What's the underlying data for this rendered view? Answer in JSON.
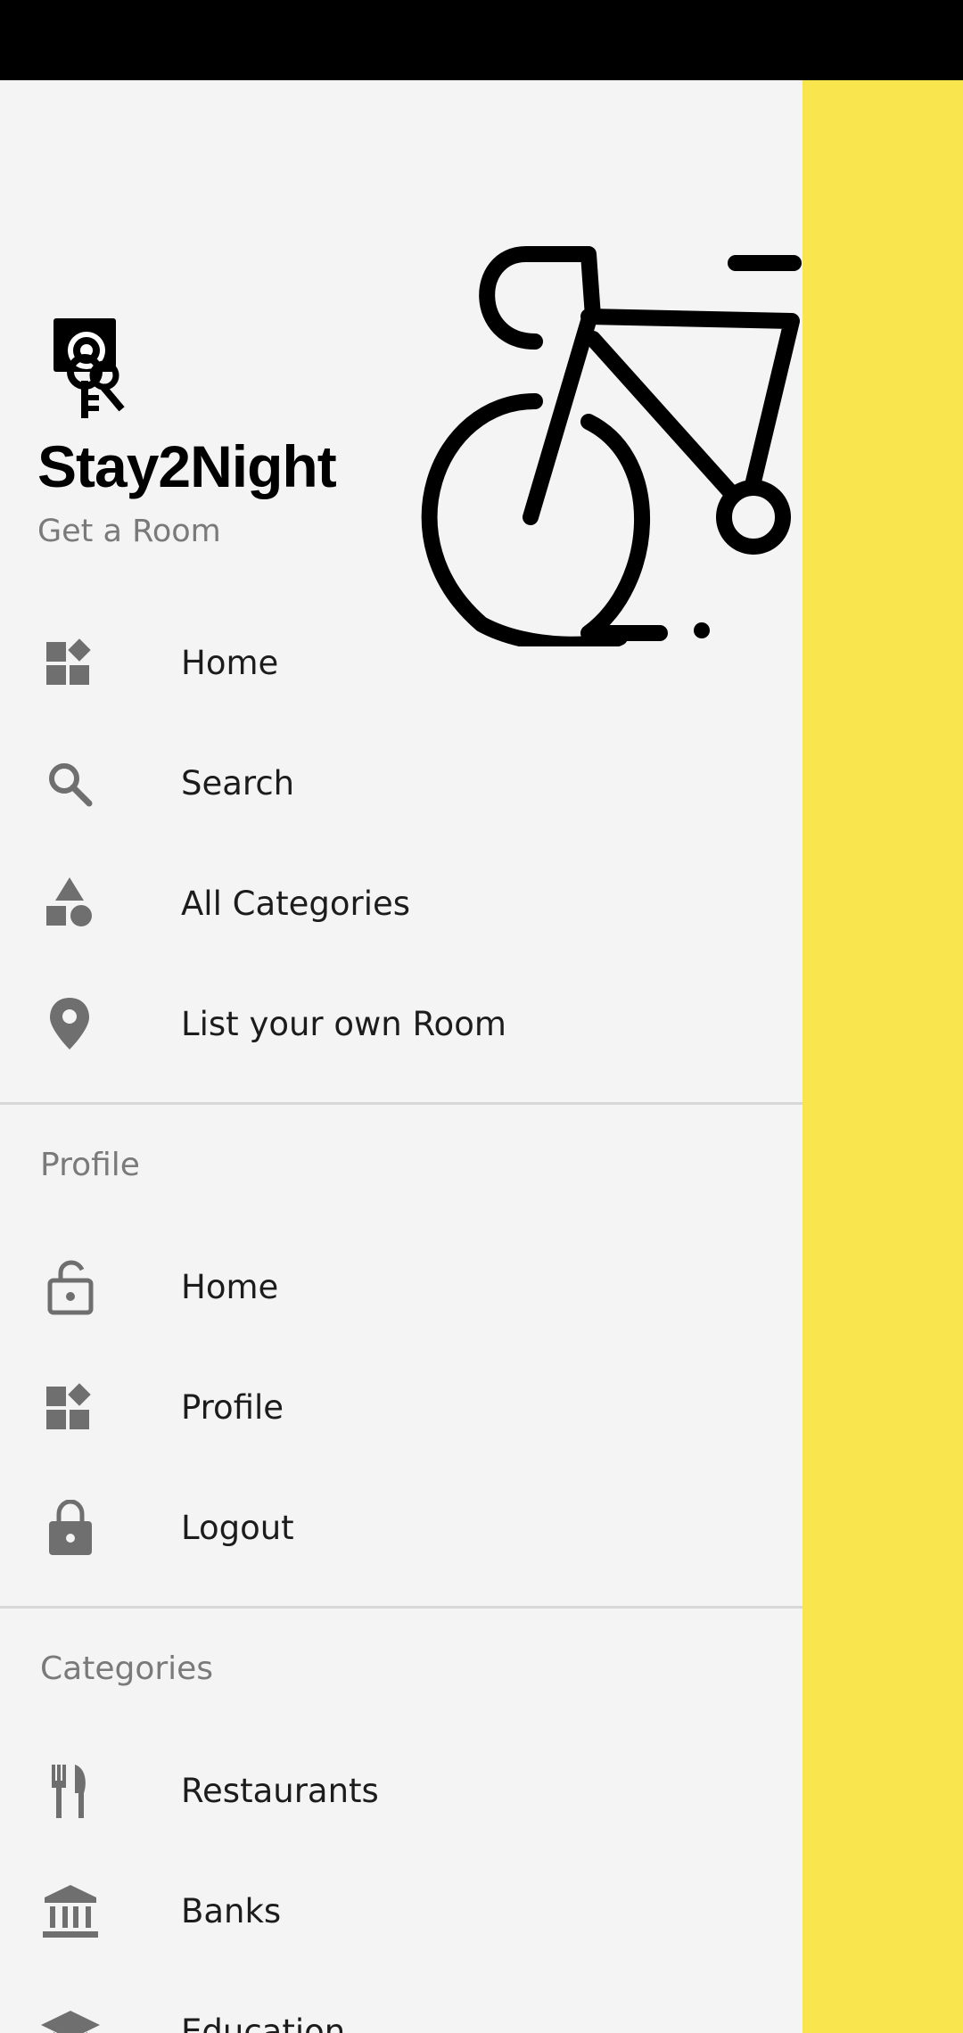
{
  "header": {
    "app_title": "Stay2Night",
    "app_subtitle": "Get a Room"
  },
  "menu": {
    "main_items": [
      {
        "label": "Home",
        "icon": "dashboard-icon"
      },
      {
        "label": "Search",
        "icon": "search-icon"
      },
      {
        "label": "All Categories",
        "icon": "category-shapes-icon"
      },
      {
        "label": "List your own Room",
        "icon": "location-pin-icon"
      }
    ],
    "profile_section": {
      "title": "Profile",
      "items": [
        {
          "label": "Home",
          "icon": "lock-open-icon"
        },
        {
          "label": "Profile",
          "icon": "dashboard-icon"
        },
        {
          "label": "Logout",
          "icon": "lock-icon"
        }
      ]
    },
    "categories_section": {
      "title": "Categories",
      "items": [
        {
          "label": "Restaurants",
          "icon": "restaurant-icon"
        },
        {
          "label": "Banks",
          "icon": "bank-icon"
        },
        {
          "label": "Education",
          "icon": "school-icon"
        }
      ]
    }
  },
  "colors": {
    "accent": "#F9E54E",
    "drawer_background": "#F4F4F4",
    "icon": "#6f6f6f"
  }
}
